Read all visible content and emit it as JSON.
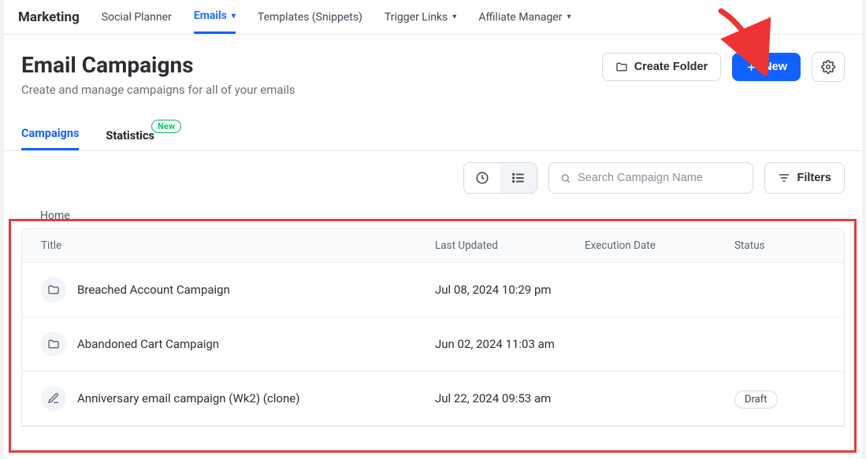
{
  "nav": {
    "brand": "Marketing",
    "items": [
      {
        "label": "Social Planner"
      },
      {
        "label": "Emails"
      },
      {
        "label": "Templates (Snippets)"
      },
      {
        "label": "Trigger Links"
      },
      {
        "label": "Affiliate Manager"
      }
    ]
  },
  "header": {
    "title": "Email Campaigns",
    "subtitle": "Create and manage campaigns for all of your emails",
    "create_folder_label": "Create Folder",
    "new_label": "New"
  },
  "subnav": {
    "campaigns_label": "Campaigns",
    "statistics_label": "Statistics",
    "new_badge": "New"
  },
  "toolbar": {
    "search_placeholder": "Search Campaign Name",
    "filters_label": "Filters"
  },
  "breadcrumb": "Home",
  "columns": {
    "title": "Title",
    "updated": "Last Updated",
    "execution": "Execution Date",
    "status": "Status"
  },
  "rows": [
    {
      "title": "Breached Account Campaign",
      "updated": "Jul 08, 2024 10:29 pm",
      "execution": "",
      "status": "",
      "icon": "folder"
    },
    {
      "title": "Abandoned Cart Campaign",
      "updated": "Jun 02, 2024 11:03 am",
      "execution": "",
      "status": "",
      "icon": "folder"
    },
    {
      "title": "Anniversary email campaign (Wk2) (clone)",
      "updated": "Jul 22, 2024 09:53 am",
      "execution": "",
      "status": "Draft",
      "icon": "edit"
    }
  ]
}
